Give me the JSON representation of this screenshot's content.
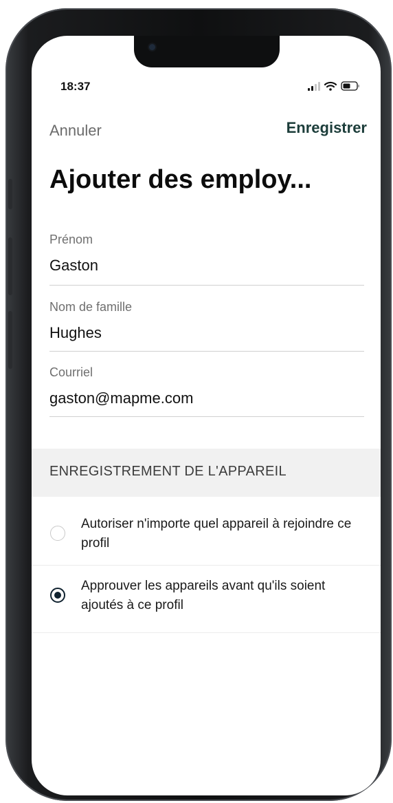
{
  "status_bar": {
    "time": "18:37",
    "icons": [
      "signal-icon",
      "wifi-icon",
      "battery-icon"
    ]
  },
  "nav": {
    "cancel_label": "Annuler",
    "save_label": "Enregistrer"
  },
  "title": "Ajouter des employ...",
  "fields": {
    "first_name": {
      "label": "Prénom",
      "value": "Gaston"
    },
    "last_name": {
      "label": "Nom de famille",
      "value": "Hughes"
    },
    "email": {
      "label": "Courriel",
      "value": "gaston@mapme.com"
    }
  },
  "device_registration": {
    "header": "ENREGISTREMENT DE L'APPAREIL",
    "options": [
      {
        "label": "Autoriser n'importe quel appareil à rejoindre ce profil",
        "selected": false
      },
      {
        "label": "Approuver les appareils avant qu'ils soient ajoutés à ce profil",
        "selected": true
      }
    ]
  },
  "colors": {
    "accent": "#1c3d3a",
    "radio_selected": "#10222f",
    "section_bg": "#f1f1f1"
  }
}
